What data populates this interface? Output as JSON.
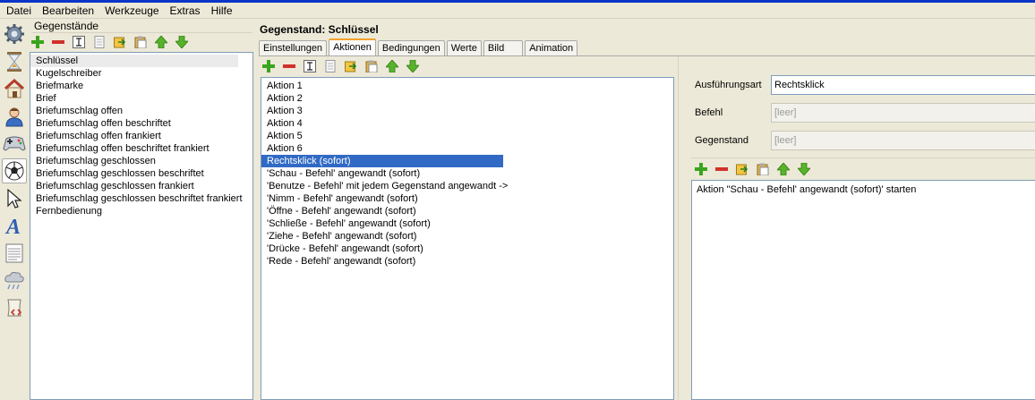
{
  "menu": [
    "Datei",
    "Bearbeiten",
    "Werkzeuge",
    "Extras",
    "Hilfe"
  ],
  "tools": [
    {
      "name": "gear-icon"
    },
    {
      "name": "hourglass-icon"
    },
    {
      "name": "house-icon"
    },
    {
      "name": "person-icon"
    },
    {
      "name": "gamepad-icon"
    },
    {
      "name": "ball-icon"
    },
    {
      "name": "cursor-icon"
    },
    {
      "name": "text-icon"
    },
    {
      "name": "document-icon"
    },
    {
      "name": "weather-icon"
    },
    {
      "name": "script-icon"
    }
  ],
  "objects_panel": {
    "title": "Gegenstände",
    "items": [
      "Schlüssel",
      "Kugelschreiber",
      "Briefmarke",
      "Brief",
      "Briefumschlag offen",
      "Briefumschlag offen beschriftet",
      "Briefumschlag offen frankiert",
      "Briefumschlag offen beschriftet frankiert",
      "Briefumschlag geschlossen",
      "Briefumschlag geschlossen beschriftet",
      "Briefumschlag geschlossen frankiert",
      "Briefumschlag geschlossen beschriftet frankiert",
      "Fernbedienung"
    ],
    "selected_index": 0
  },
  "editor": {
    "title": "Gegenstand: Schlüssel",
    "tabs": [
      "Einstellungen",
      "Aktionen",
      "Bedingungen",
      "Werte",
      "Bild",
      "Animation"
    ],
    "active_tab": 1
  },
  "actions": {
    "items": [
      "Aktion 1",
      "Aktion 2",
      "Aktion 3",
      "Aktion 4",
      "Aktion 5",
      "Aktion 6",
      "Rechtsklick (sofort)",
      "'Schau - Befehl' angewandt (sofort)",
      "'Benutze - Befehl' mit jedem Gegenstand angewandt ->",
      "'Nimm - Befehl' angewandt (sofort)",
      "'Öffne - Befehl' angewandt (sofort)",
      "'Schließe - Befehl' angewandt (sofort)",
      "'Ziehe - Befehl' angewandt (sofort)",
      "'Drücke - Befehl' angewandt (sofort)",
      "'Rede - Befehl' angewandt (sofort)"
    ],
    "selected_index": 6
  },
  "properties": {
    "execution_label": "Ausführungsart",
    "execution_value": "Rechtsklick",
    "command_label": "Befehl",
    "command_value": "[leer]",
    "object_label": "Gegenstand",
    "object_value": "[leer]"
  },
  "script": {
    "items": [
      "Aktion \"Schau - Befehl' angewandt (sofort)' starten"
    ]
  },
  "colors": {
    "selection": "#316ac5",
    "window_bg": "#ece9d8",
    "tab_accent": "#f3a12b"
  }
}
